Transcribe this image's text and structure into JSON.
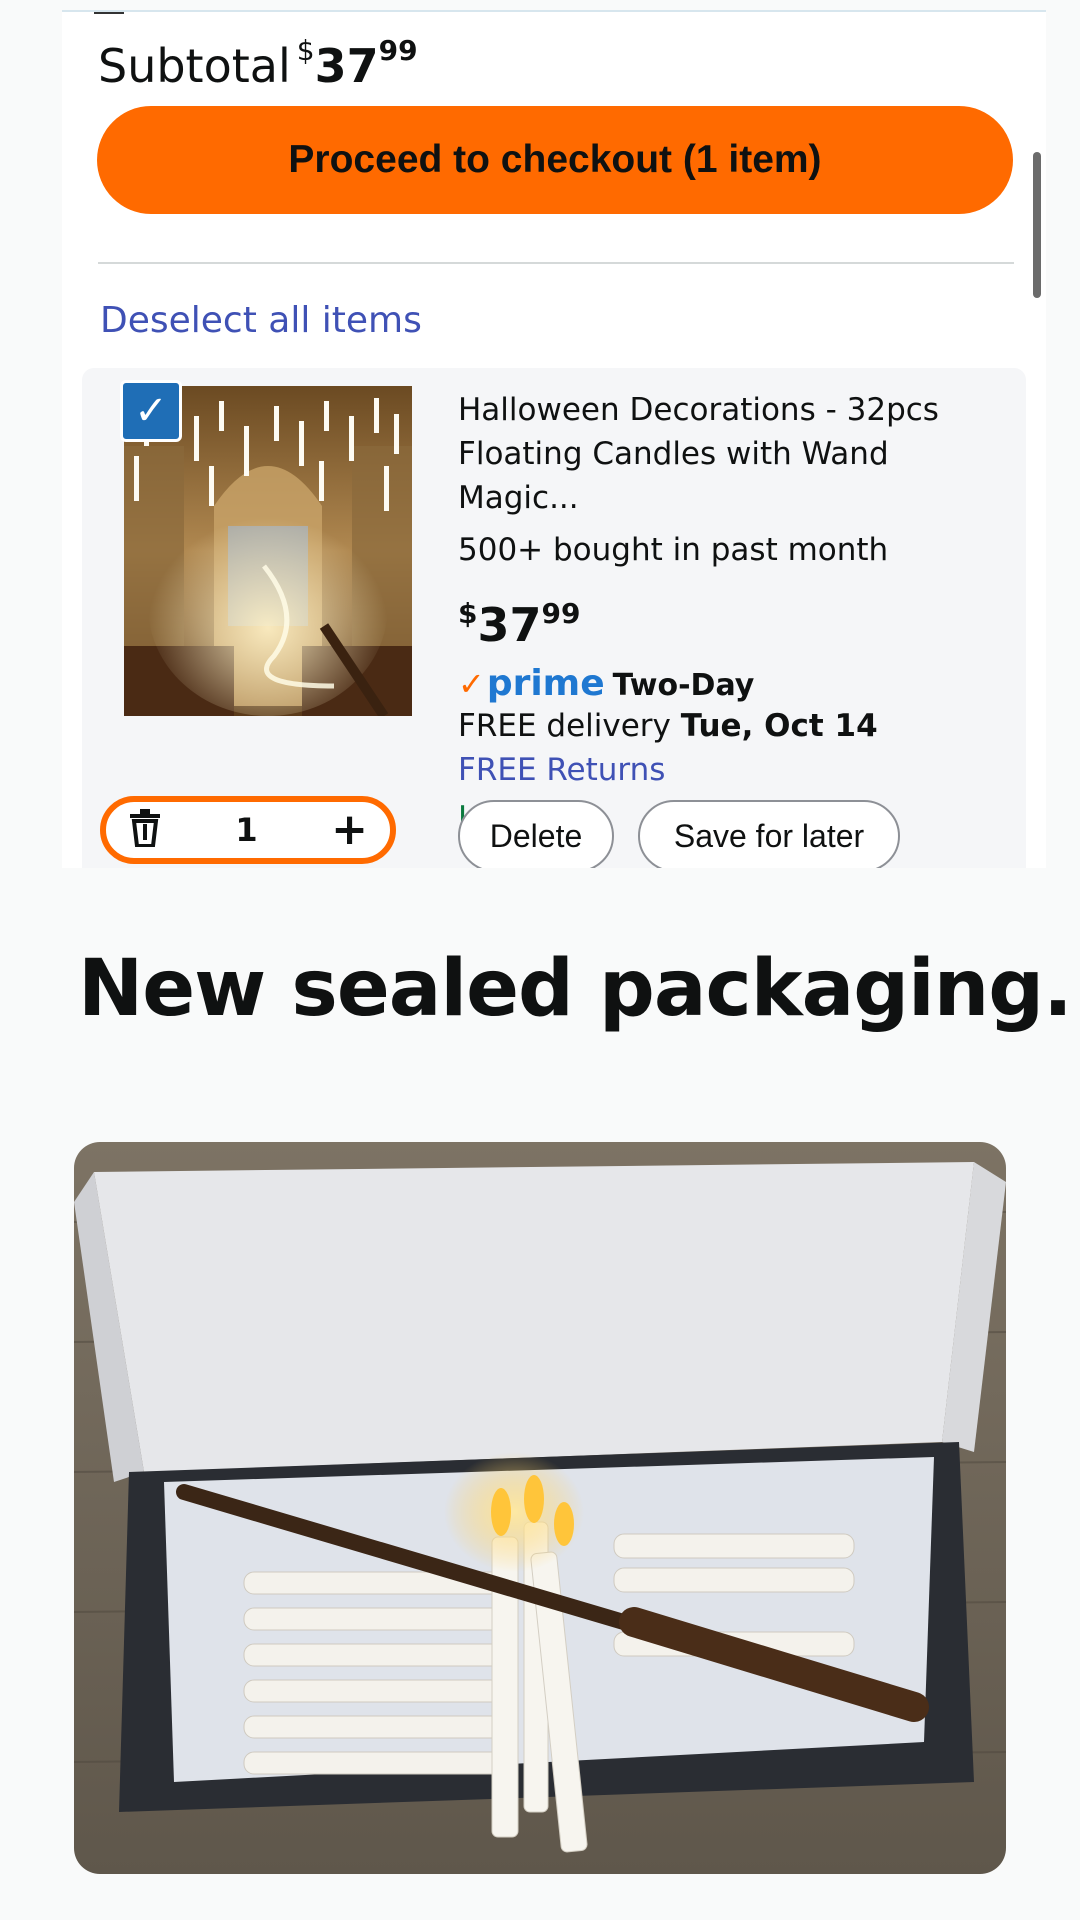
{
  "cart": {
    "subtotal_label": "Subtotal",
    "subtotal_currency": "$",
    "subtotal_whole": "37",
    "subtotal_cents": "99",
    "checkout_label": "Proceed to checkout (1 item)",
    "deselect_label": "Deselect all items"
  },
  "item": {
    "title_line1": "Halloween Decorations - 32pcs",
    "title_line2": "Floating Candles with Wand Magic...",
    "bought": "500+ bought in past month",
    "price_currency": "$",
    "price_whole": "37",
    "price_cents": "99",
    "prime_word": "prime",
    "prime_speed": "Two-Day",
    "delivery_prefix": "FREE delivery",
    "delivery_date": "Tue, Oct 14",
    "returns": "FREE Returns",
    "stock": "In Stock",
    "quantity": "1",
    "delete_label": "Delete",
    "save_label": "Save for later",
    "selected": true
  },
  "caption": "New sealed packaging.",
  "colors": {
    "accent_orange": "#ff6a00",
    "link_blue": "#3f51b5",
    "prime_blue": "#1f78d1",
    "stock_green": "#0a7a3e",
    "checkbox_blue": "#1f6eb6"
  },
  "icons": [
    "check-icon",
    "trash-icon",
    "plus-icon",
    "prime-check-icon"
  ]
}
